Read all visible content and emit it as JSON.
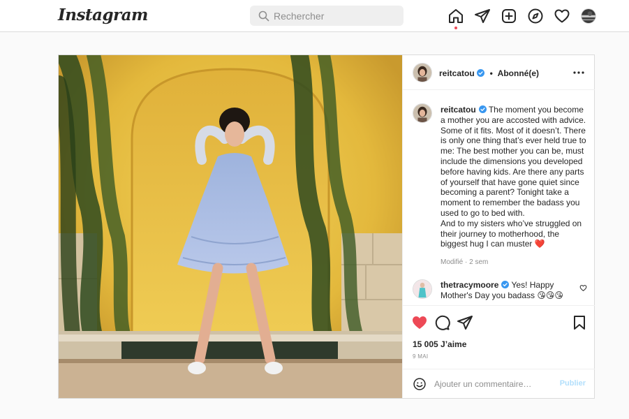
{
  "app": {
    "logo_text": "Instagram"
  },
  "search": {
    "placeholder": "Rechercher",
    "icon": "search-icon"
  },
  "nav": {
    "icons": [
      "home-icon",
      "direct-message-icon",
      "new-post-icon",
      "explore-icon",
      "activity-heart-icon",
      "profile-avatar"
    ],
    "active": "home-icon",
    "notification_dot_color": "#ed4956"
  },
  "post": {
    "author": {
      "username": "reitcatou",
      "verified": true,
      "separator": "•",
      "follow_state": "Abonné(e)"
    },
    "caption": {
      "username": "reitcatou",
      "text_part1": "The moment you become a mother you are accosted with advice. Some of it fits. Most of it doesn’t. There is only one thing that’s ever held true to me: The best mother you can be, must include the dimensions you developed before having kids. Are there any parts of yourself that have gone quiet since becoming a parent? Tonight take a moment to remember the badass you used to go to bed with.",
      "text_part2": "And to my sisters who’ve struggled on their journey to motherhood, the biggest hug I can muster",
      "emoji": "❤️",
      "meta": "Modifié · 2 sem"
    },
    "comments": [
      {
        "username": "thetracymoore",
        "verified": true,
        "text": "Yes! Happy Mother's Day you badass",
        "emoji": "😘😘😘"
      }
    ],
    "liked": true,
    "like_color": "#ed4956",
    "likes": "15 005 J’aime",
    "date": "9 MAI",
    "add_comment": {
      "placeholder": "Ajouter un commentaire…",
      "publish_label": "Publier",
      "publish_color": "#b2dffc"
    }
  }
}
